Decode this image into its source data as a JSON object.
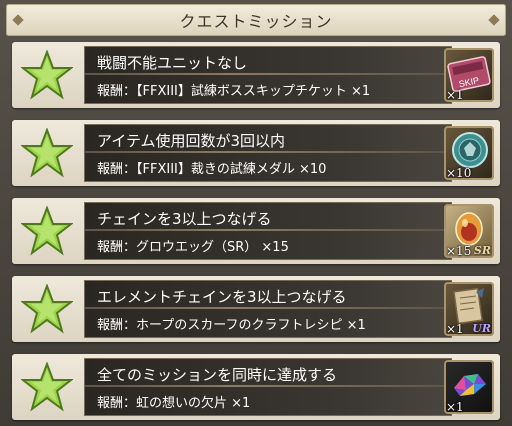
{
  "header": {
    "title": "クエストミッション"
  },
  "missions": [
    {
      "title": "戦闘不能ユニットなし",
      "reward": "報酬：【FFXIII】試練ボススキップチケット ×1",
      "item": {
        "icon": "skip-ticket-icon",
        "quantity": "×1",
        "rarity": "",
        "ticket_text": "SKIP"
      }
    },
    {
      "title": "アイテム使用回数が3回以内",
      "reward": "報酬：【FFXIII】裁きの試練メダル ×10",
      "item": {
        "icon": "trial-medal-icon",
        "quantity": "×10",
        "rarity": ""
      }
    },
    {
      "title": "チェインを3以上つなげる",
      "reward": "報酬：グロウエッグ（SR） ×15",
      "item": {
        "icon": "grow-egg-icon",
        "quantity": "×15",
        "rarity": "SR"
      }
    },
    {
      "title": "エレメントチェインを3以上つなげる",
      "reward": "報酬：ホープのスカーフのクラフトレシピ ×1",
      "item": {
        "icon": "craft-recipe-icon",
        "quantity": "×1",
        "rarity": "UR"
      }
    },
    {
      "title": "全てのミッションを同時に達成する",
      "reward": "報酬：虹の想いの欠片 ×1",
      "item": {
        "icon": "rainbow-shard-icon",
        "quantity": "×1",
        "rarity": ""
      }
    }
  ],
  "colors": {
    "star_fill": "#9cd34a",
    "panel_bg": "#2f2b26",
    "card_bg": "#ece5d6",
    "header_bg": "#e9e1cd"
  }
}
